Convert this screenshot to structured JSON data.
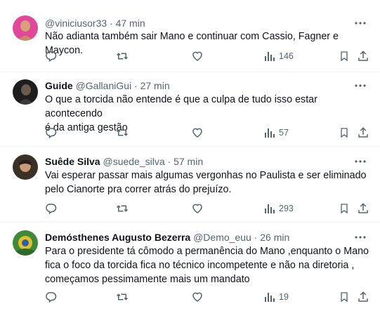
{
  "tweets": [
    {
      "name": "",
      "handle": "@viniciusor33",
      "sep": "·",
      "time": "47 min",
      "lines": [
        "Não adianta também sair Mano e continuar com Cassio, Fagner e Maycon."
      ],
      "views": "146"
    },
    {
      "name": "Guide",
      "handle": "@GallaniGui",
      "sep": "·",
      "time": "27 min",
      "lines": [
        "O que a torcida não entende é que a culpa de tudo isso estar acontecendo",
        "é da antiga gestão"
      ],
      "views": "57"
    },
    {
      "name": "Suêde Silva",
      "handle": "@suede_silva",
      "sep": "·",
      "time": "57 min",
      "lines": [
        "Vai esperar passar mais algumas vergonhas no Paulista e ser eliminado",
        "pelo Cianorte pra correr atrás do prejuízo."
      ],
      "views": "293"
    },
    {
      "name": "Demósthenes Augusto Bezerra",
      "handle": "@Demo_euu",
      "sep": "·",
      "time": "26 min",
      "lines": [
        "Para o presidente tá cômodo a permanência do Mano ,enquanto o Mano",
        "fica o foco da torcida fica no técnico incompetente e não na diretoria ,",
        "começamos pessimamente mais um mandato"
      ],
      "views": "19"
    }
  ],
  "icons": {
    "reply": "reply-icon",
    "retweet": "retweet-icon",
    "like": "like-icon",
    "views": "views-icon",
    "bookmark": "bookmark-icon",
    "share": "share-icon",
    "more": "more-icon"
  },
  "colors": {
    "text": "#0f1419",
    "muted": "#536471",
    "divider": "#eff3f4",
    "avatar1": "#e0489a"
  }
}
